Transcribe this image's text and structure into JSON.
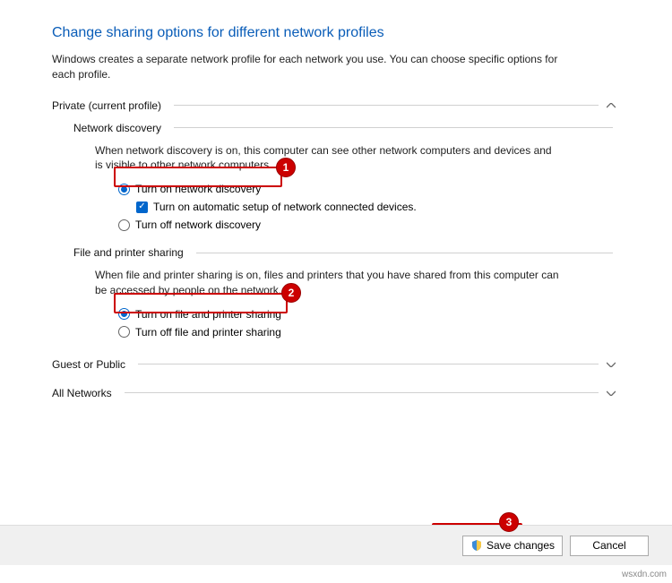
{
  "page": {
    "title": "Change sharing options for different network profiles",
    "description": "Windows creates a separate network profile for each network you use. You can choose specific options for each profile."
  },
  "sections": {
    "private": {
      "label": "Private (current profile)"
    },
    "guest": {
      "label": "Guest or Public"
    },
    "all": {
      "label": "All Networks"
    }
  },
  "network_discovery": {
    "heading": "Network discovery",
    "description": "When network discovery is on, this computer can see other network computers and devices and is visible to other network computers.",
    "turn_on": "Turn on network discovery",
    "auto_setup": "Turn on automatic setup of network connected devices.",
    "turn_off": "Turn off network discovery"
  },
  "file_printer": {
    "heading": "File and printer sharing",
    "description": "When file and printer sharing is on, files and printers that you have shared from this computer can be accessed by people on the network.",
    "turn_on": "Turn on file and printer sharing",
    "turn_off": "Turn off file and printer sharing"
  },
  "buttons": {
    "save": "Save changes",
    "cancel": "Cancel"
  },
  "badges": {
    "one": "1",
    "two": "2",
    "three": "3"
  },
  "watermark": "wsxdn.com"
}
